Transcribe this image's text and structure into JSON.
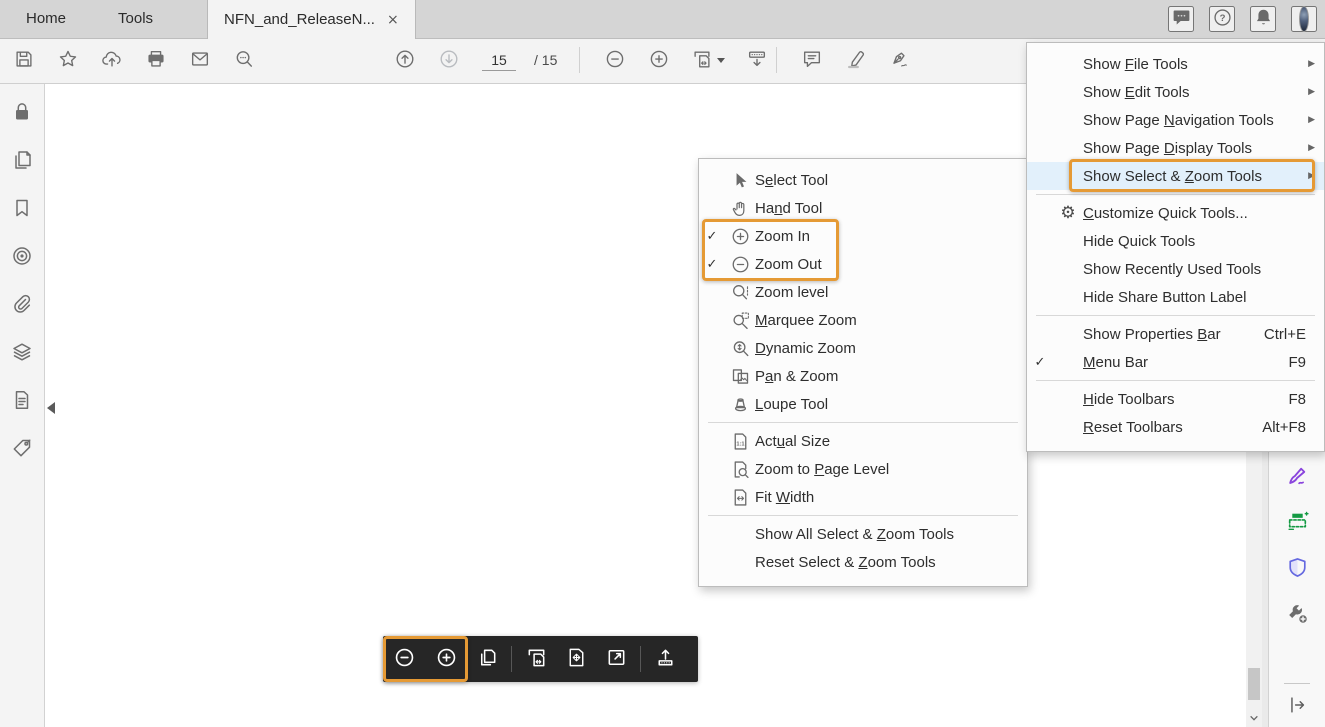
{
  "colors": {
    "accent": "#e59a35",
    "menu_highlight": "#e2f0fb",
    "dark_toolbar": "#262626"
  },
  "tabbar": {
    "tabs": [
      {
        "label": "Home"
      },
      {
        "label": "Tools"
      },
      {
        "label": "NFN_and_ReleaseN...",
        "close": "×",
        "active": true
      }
    ],
    "topright_icons": [
      {
        "name": "comments",
        "icon": "chat"
      },
      {
        "name": "help",
        "icon": "help"
      },
      {
        "name": "notifications",
        "icon": "bell"
      },
      {
        "name": "account-avatar",
        "icon": "avatar"
      }
    ]
  },
  "toolbar": {
    "left_icons": [
      {
        "name": "save",
        "icon": "save"
      },
      {
        "name": "star",
        "icon": "star"
      },
      {
        "name": "share-upload",
        "icon": "upload"
      },
      {
        "name": "print",
        "icon": "print"
      },
      {
        "name": "email",
        "icon": "email"
      },
      {
        "name": "search",
        "icon": "search"
      }
    ],
    "page_nav": {
      "current": "15",
      "separator": "/",
      "total": "15"
    },
    "right_icons": [
      {
        "name": "comment",
        "icon": "comment"
      },
      {
        "name": "highlight-text",
        "icon": "highlight"
      },
      {
        "name": "fill-sign",
        "icon": "sign"
      }
    ]
  },
  "left_sidebar": [
    {
      "name": "security-lock",
      "icon": "lock"
    },
    {
      "name": "page-thumbnails",
      "icon": "copypages"
    },
    {
      "name": "bookmarks",
      "icon": "bookmark"
    },
    {
      "name": "destinations",
      "icon": "target"
    },
    {
      "name": "attachments",
      "icon": "paperclip"
    },
    {
      "name": "layers",
      "icon": "layers"
    },
    {
      "name": "content",
      "icon": "filelines"
    },
    {
      "name": "tags",
      "icon": "tag"
    }
  ],
  "right_sidebar": [
    {
      "name": "fill-and-sign",
      "icon": "rs-pen",
      "color": "#8a45dd"
    },
    {
      "name": "organize-pages",
      "icon": "rs-organize",
      "color": "#149a43"
    },
    {
      "name": "protect",
      "icon": "rs-shield",
      "color": "#6468e0"
    },
    {
      "name": "more-tools",
      "icon": "rs-wrench",
      "color": "#6e6e6e"
    }
  ],
  "select_zoom_menu": {
    "items": [
      {
        "name": "select-tool",
        "label": "Select Tool",
        "mnemonic": "e",
        "icon": "cursor"
      },
      {
        "name": "hand-tool",
        "label": "Hand Tool",
        "mnemonic": "n",
        "icon": "hand"
      },
      {
        "name": "zoom-in",
        "label": "Zoom In",
        "checked": true,
        "icon": "zoomin"
      },
      {
        "name": "zoom-out",
        "label": "Zoom Out",
        "checked": true,
        "icon": "zoomout"
      },
      {
        "name": "zoom-level",
        "label": "Zoom level",
        "icon": "zoomlevel"
      },
      {
        "name": "marquee-zoom",
        "label": "Marquee Zoom",
        "mnemonic": "M",
        "icon": "marquee"
      },
      {
        "name": "dynamic-zoom",
        "label": "Dynamic Zoom",
        "mnemonic": "D",
        "icon": "dynamic"
      },
      {
        "name": "pan-and-zoom",
        "label": "Pan & Zoom",
        "mnemonic": "a",
        "icon": "pan"
      },
      {
        "name": "loupe-tool",
        "label": "Loupe Tool",
        "mnemonic": "L",
        "icon": "loupe"
      },
      {
        "separator": true
      },
      {
        "name": "actual-size",
        "label": "Actual Size",
        "mnemonic": "u",
        "icon": "actual"
      },
      {
        "name": "zoom-to-page-level",
        "label": "Zoom to Page Level",
        "mnemonic": "P",
        "icon": "zoompage"
      },
      {
        "name": "fit-width",
        "label": "Fit Width",
        "mnemonic": "W",
        "icon": "fitwidth"
      },
      {
        "separator": true
      },
      {
        "name": "show-all-select-zoom-tools",
        "label": "Show All Select & Zoom Tools",
        "mnemonic": "Z"
      },
      {
        "name": "reset-select-zoom-tools",
        "label": "Reset Select & Zoom Tools",
        "mnemonic": "Z"
      }
    ]
  },
  "quick_tools_menu": {
    "items": [
      {
        "name": "show-file-tools",
        "label": "Show File Tools",
        "mnemonic": "F",
        "submenu": true
      },
      {
        "name": "show-edit-tools",
        "label": "Show Edit Tools",
        "mnemonic": "E",
        "submenu": true
      },
      {
        "name": "show-page-navigation-tools",
        "label": "Show Page Navigation Tools",
        "mnemonic": "N",
        "submenu": true
      },
      {
        "name": "show-page-display-tools",
        "label": "Show Page Display Tools",
        "mnemonic": "D",
        "submenu": true
      },
      {
        "name": "show-select-zoom-tools",
        "label": "Show Select & Zoom Tools",
        "mnemonic": "Z",
        "submenu": true,
        "highlighted": true
      },
      {
        "separator": true
      },
      {
        "name": "customize-quick-tools",
        "label": "Customize Quick Tools...",
        "mnemonic": "C",
        "icon": "gear"
      },
      {
        "name": "hide-quick-tools",
        "label": "Hide Quick Tools"
      },
      {
        "name": "show-recently-used-tools",
        "label": "Show Recently Used Tools"
      },
      {
        "name": "hide-share-button-label",
        "label": "Hide Share Button Label"
      },
      {
        "separator": true
      },
      {
        "name": "show-properties-bar",
        "label": "Show Properties Bar",
        "mnemonic": "B",
        "shortcut": "Ctrl+E"
      },
      {
        "name": "menu-bar",
        "label": "Menu Bar",
        "mnemonic": "M",
        "shortcut": "F9",
        "checked": true
      },
      {
        "separator": true
      },
      {
        "name": "hide-toolbars",
        "label": "Hide Toolbars",
        "mnemonic": "H",
        "shortcut": "F8"
      },
      {
        "name": "reset-toolbars",
        "label": "Reset Toolbars",
        "mnemonic": "R",
        "shortcut": "Alt+F8"
      }
    ]
  },
  "bottom_toolbar": {
    "items": [
      {
        "name": "zoom-out",
        "icon": "d-zoomout",
        "first": true
      },
      {
        "name": "zoom-in",
        "icon": "d-zoomin",
        "first": true
      },
      {
        "name": "page-thumbnails",
        "icon": "d-pages"
      },
      {
        "separator": true
      },
      {
        "name": "fit-width",
        "icon": "d-fitw"
      },
      {
        "name": "fit-one-full-page",
        "icon": "d-fitp"
      },
      {
        "name": "full-screen",
        "icon": "d-full"
      },
      {
        "separator": true
      },
      {
        "name": "show-main-toolbar",
        "icon": "d-share"
      }
    ]
  }
}
